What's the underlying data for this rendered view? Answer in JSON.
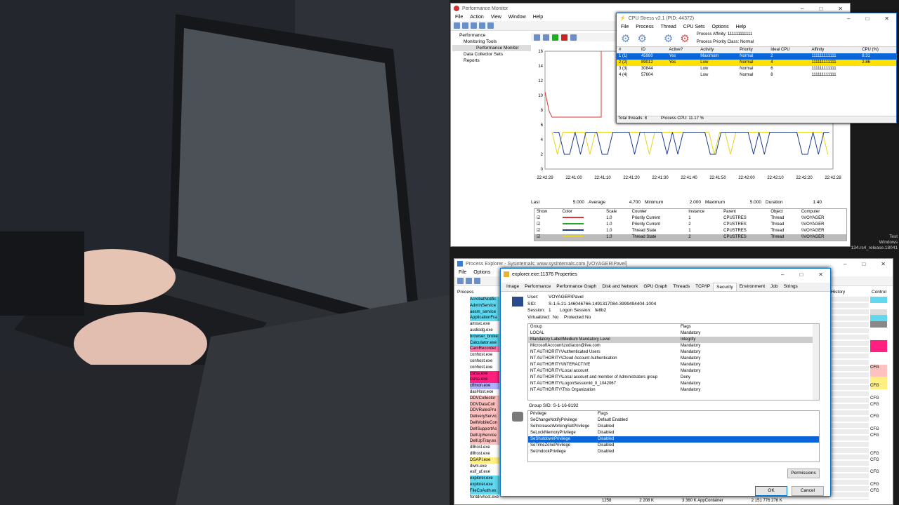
{
  "perfmon": {
    "title": "Performance Monitor",
    "menu": [
      "File",
      "Action",
      "View",
      "Window",
      "Help"
    ],
    "tree": [
      "Performance",
      "Monitoring Tools",
      "Performance Monitor",
      "Data Collector Sets",
      "Reports"
    ],
    "yticks": [
      "16",
      "14",
      "12",
      "10",
      "8",
      "6",
      "4",
      "2",
      "0"
    ],
    "xticks": [
      "22:42:29",
      "22:41:00",
      "22:41:10",
      "22:41:20",
      "22:41:30",
      "22:41:40",
      "22:41:50",
      "22:42:00",
      "22:42:10",
      "22:42:20",
      "22:42:28"
    ],
    "stats": {
      "last_label": "Last",
      "last": "5.000",
      "avg_label": "Average",
      "avg": "4.700",
      "min_label": "Minimum",
      "min": "2.000",
      "max_label": "Maximum",
      "max": "5.000",
      "dur_label": "Duration",
      "dur": "1:40"
    },
    "legend_headers": [
      "Show",
      "Color",
      "Scale",
      "Counter",
      "Instance",
      "Parent",
      "Object",
      "Computer"
    ],
    "legend_rows": [
      [
        "1.0",
        "Priority Current",
        "1",
        "CPUSTRES",
        "Thread",
        "\\\\VOYAGER"
      ],
      [
        "1.0",
        "Priority Current",
        "2",
        "CPUSTRES",
        "Thread",
        "\\\\VOYAGER"
      ],
      [
        "1.0",
        "Thread State",
        "1",
        "CPUSTRES",
        "Thread",
        "\\\\VOYAGER"
      ],
      [
        "1.0",
        "Thread State",
        "2",
        "CPUSTRES",
        "Thread",
        "\\\\VOYAGER"
      ]
    ]
  },
  "cpustress": {
    "title": "CPU Stress v2.1 (PID: 44372)",
    "menu": [
      "File",
      "Process",
      "Thread",
      "CPU Sets",
      "Options",
      "Help"
    ],
    "affinity": "Process Affinity: 111111111111",
    "priority": "Process Priority Class: Normal",
    "headers": [
      "#",
      "ID",
      "Active?",
      "Activity",
      "Priority",
      "Ideal CPU",
      "Affinity",
      "CPU (%)"
    ],
    "rows": [
      [
        "1 (1)",
        "45980",
        "Yes",
        "Maximum",
        "Normal",
        "2",
        "111111111111",
        "8.31"
      ],
      [
        "2 (2)",
        "89012",
        "Yes",
        "Low",
        "Normal",
        "4",
        "111111111111",
        "2.86"
      ],
      [
        "3 (3)",
        "30844",
        "",
        "Low",
        "Normal",
        "6",
        "111111111111",
        ""
      ],
      [
        "4 (4)",
        "57604",
        "",
        "Low",
        "Normal",
        "8",
        "111111111111",
        ""
      ]
    ],
    "status_threads": "Total threads: 8",
    "status_cpu": "Process CPU: 11.17 %"
  },
  "taskbar_text": [
    "Test",
    "Windows",
    "134.rs4_release.18041"
  ],
  "procexp": {
    "title": "Process Explorer - Sysinternals: www.sysinternals.com [VOYAGER\\Pavel]",
    "menu": [
      "File",
      "Options"
    ],
    "col_process": "Process",
    "col_history": "History",
    "col_control": "Control",
    "processes": [
      "AcrobatNotific",
      "AdminService",
      "aesm_service",
      "ApplicationFra",
      "amsvc.exe",
      "audiodg.exe",
      "browser_broke",
      "Calculator.exe",
      "CamRecorder",
      "conhost.exe",
      "conhost.exe",
      "conhost.exe",
      "csrss.exe",
      "csrss.exe",
      "ctfmon.exe",
      "dasHost.exe",
      "DDVCollector",
      "DDVDataColl",
      "DDVRulesPro",
      "DeliveryServic",
      "DellMobileCon",
      "DellSupportAs",
      "DellUpService",
      "DellUpTray.ex",
      "dllhost.exe",
      "dllhost.exe",
      "DSAPI.exe",
      "dwm.exe",
      "esif_uf.exe",
      "explorer.exe",
      "explorer.exe",
      "FileCoAuth.ex",
      "fontdrvhost.exe"
    ],
    "cfg": [
      "CFG",
      "CFG",
      "CFG",
      "CFG",
      "CFG",
      "CFG",
      "CFG",
      "CFG",
      "CFG",
      "CFG",
      "CFG",
      "CFG",
      "CFG",
      "CFG",
      "CFG"
    ],
    "bottom_row": [
      "1258",
      "2 208 K",
      "3 360 K  AppContainer",
      "2 151 776 276 K"
    ]
  },
  "props": {
    "title": "explorer.exe:11376 Properties",
    "tabs": [
      "Image",
      "Performance",
      "Performance Graph",
      "Disk and Network",
      "GPU Graph",
      "Threads",
      "TCP/IP",
      "Security",
      "Environment",
      "Job",
      "Strings"
    ],
    "user_label": "User:",
    "user": "VOYAGER\\Pavel",
    "sid_label": "SID:",
    "sid": "S-1-5-21-146046766-1491317084-3999494404-1004",
    "session_label": "Session:",
    "session": "1",
    "logon_label": "Logon Session:",
    "logon": "fe8b2",
    "virt_label": "Virtualized:",
    "virt": "No",
    "prot_label": "Protected:",
    "prot": "No",
    "group_headers": [
      "Group",
      "Flags"
    ],
    "groups": [
      [
        "LOCAL",
        "Mandatory"
      ],
      [
        "Mandatory Label\\Medium Mandatory Level",
        "Integrity"
      ],
      [
        "MicrosoftAccount\\zodiacon@live.com",
        "Mandatory"
      ],
      [
        "NT AUTHORITY\\Authenticated Users",
        "Mandatory"
      ],
      [
        "NT AUTHORITY\\Cloud Account Authentication",
        "Mandatory"
      ],
      [
        "NT AUTHORITY\\INTERACTIVE",
        "Mandatory"
      ],
      [
        "NT AUTHORITY\\Local account",
        "Mandatory"
      ],
      [
        "NT AUTHORITY\\Local account and member of Administrators group",
        "Deny"
      ],
      [
        "NT AUTHORITY\\LogonSessionId_0_1042067",
        "Mandatory"
      ],
      [
        "NT AUTHORITY\\This Organization",
        "Mandatory"
      ]
    ],
    "group_sid": "Group SID:   S-1-16-8192",
    "priv_headers": [
      "Privilege",
      "Flags"
    ],
    "privs": [
      [
        "SeChangeNotifyPrivilege",
        "Default Enabled"
      ],
      [
        "SeIncreaseWorkingSetPrivilege",
        "Disabled"
      ],
      [
        "SeLockMemoryPrivilege",
        "Disabled"
      ],
      [
        "SeShutdownPrivilege",
        "Disabled"
      ],
      [
        "SeTimeZonePrivilege",
        "Disabled"
      ],
      [
        "SeUndockPrivilege",
        "Disabled"
      ]
    ],
    "permissions": "Permissions",
    "ok": "OK",
    "cancel": "Cancel"
  }
}
